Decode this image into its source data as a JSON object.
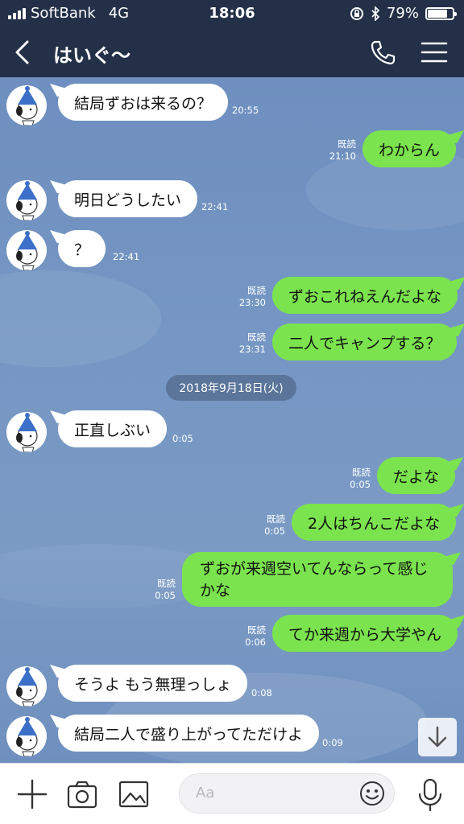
{
  "status_bar": {
    "carrier": "SoftBank",
    "network": "4G",
    "time": "18:06",
    "battery": "79%",
    "battery_level": 0.79
  },
  "header": {
    "title": "はいぐ〜",
    "icons": [
      "back-icon",
      "phone-icon",
      "menu-icon"
    ]
  },
  "messages": [
    {
      "dir": "in",
      "text": "結局ずおは来るの？",
      "time": "20:55"
    },
    {
      "dir": "out",
      "text": "わからん",
      "read": "既読",
      "time": "21:10"
    },
    {
      "dir": "in",
      "text": "明日どうしたい",
      "time": "22:41"
    },
    {
      "dir": "in",
      "text": "？",
      "time": "22:41"
    },
    {
      "dir": "out",
      "text": "ずおこれねえんだよな",
      "read": "既読",
      "time": "23:30"
    },
    {
      "dir": "out",
      "text": "二人でキャンプする？",
      "read": "既読",
      "time": "23:31"
    },
    {
      "date": "2018年9月18日(火)"
    },
    {
      "dir": "in",
      "text": "正直しぶい",
      "time": "0:05"
    },
    {
      "dir": "out",
      "text": "だよな",
      "read": "既読",
      "time": "0:05"
    },
    {
      "dir": "out",
      "text": "2人はちんこだよな",
      "read": "既読",
      "time": "0:05"
    },
    {
      "dir": "out",
      "text": "ずおが来週空いてんならって感じかな",
      "read": "既読",
      "time": "0:05"
    },
    {
      "dir": "out",
      "text": "てか来週から大学やん",
      "read": "既読",
      "time": "0:06"
    },
    {
      "dir": "in",
      "text": "そうよ もう無理っしょ",
      "time": "0:08"
    },
    {
      "dir": "in",
      "text": "結局二人で盛り上がってただけよ",
      "time": "0:09"
    }
  ],
  "input": {
    "placeholder": "Aa",
    "icons": [
      "plus-icon",
      "camera-icon",
      "image-icon",
      "emoji-icon",
      "mic-icon"
    ]
  },
  "colors": {
    "header": "#233048",
    "chat_bg": "#7392bf",
    "outgoing_bubble": "#7be34e",
    "incoming_bubble": "#ffffff"
  }
}
